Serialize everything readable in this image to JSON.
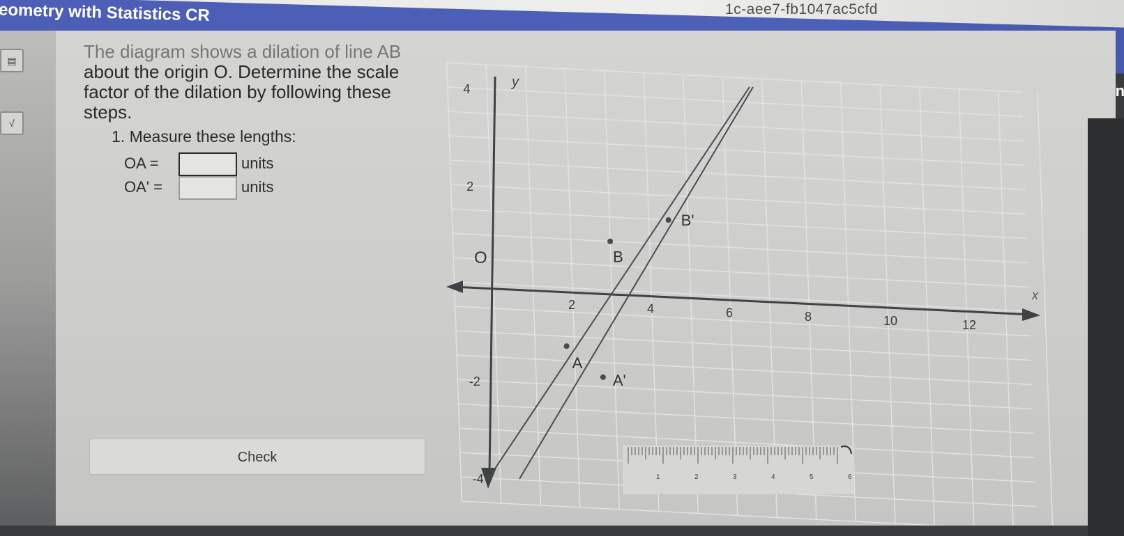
{
  "header": {
    "course_title": "Geometry with Statistics CR",
    "url_fragment": "1c-aee7-fb1047ac5cfd",
    "right_text": "En"
  },
  "sidebar": {
    "items": [
      {
        "icon": "calculator-icon"
      },
      {
        "icon": "square-root-icon",
        "label": "√"
      }
    ]
  },
  "problem": {
    "lines": [
      "The diagram shows a dilation of line AB",
      "about the origin O. Determine the scale",
      "factor of the dilation by following these",
      "steps."
    ],
    "step1": "1. Measure these lengths:",
    "measurements": [
      {
        "label": "OA  =",
        "value": "",
        "unit": "units"
      },
      {
        "label": "OA' =",
        "value": "",
        "unit": "units"
      }
    ],
    "check_label": "Check"
  },
  "graph": {
    "axis_x_label": "x",
    "axis_y_label": "y",
    "origin_label": "O",
    "x_ticks": [
      "2",
      "4",
      "6",
      "8",
      "10",
      "12"
    ],
    "y_ticks": [
      "4",
      "2",
      "-2",
      "-4"
    ],
    "points": [
      {
        "label": "A",
        "x": 1.8,
        "y": -1.2
      },
      {
        "label": "B",
        "x": 3,
        "y": 1
      },
      {
        "label": "A'",
        "x": 2.7,
        "y": -1.8
      },
      {
        "label": "B'",
        "x": 4.5,
        "y": 1.5
      }
    ]
  },
  "ruler": {
    "ticks": [
      "1",
      "2",
      "3",
      "4",
      "5",
      "6"
    ]
  }
}
